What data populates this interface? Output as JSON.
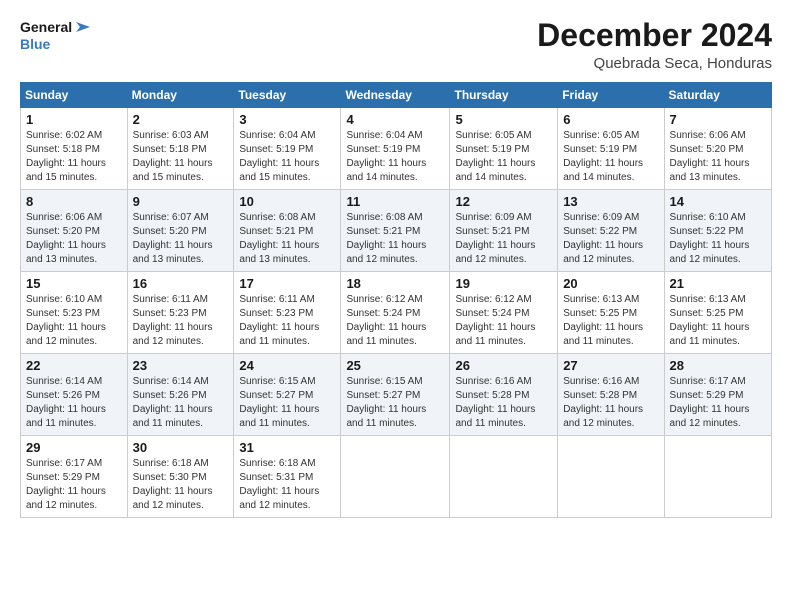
{
  "logo": {
    "line1": "General",
    "line2": "Blue"
  },
  "title": "December 2024",
  "location": "Quebrada Seca, Honduras",
  "days_of_week": [
    "Sunday",
    "Monday",
    "Tuesday",
    "Wednesday",
    "Thursday",
    "Friday",
    "Saturday"
  ],
  "weeks": [
    [
      {
        "day": "1",
        "sunrise": "6:02 AM",
        "sunset": "5:18 PM",
        "daylight": "11 hours and 15 minutes."
      },
      {
        "day": "2",
        "sunrise": "6:03 AM",
        "sunset": "5:18 PM",
        "daylight": "11 hours and 15 minutes."
      },
      {
        "day": "3",
        "sunrise": "6:04 AM",
        "sunset": "5:19 PM",
        "daylight": "11 hours and 15 minutes."
      },
      {
        "day": "4",
        "sunrise": "6:04 AM",
        "sunset": "5:19 PM",
        "daylight": "11 hours and 14 minutes."
      },
      {
        "day": "5",
        "sunrise": "6:05 AM",
        "sunset": "5:19 PM",
        "daylight": "11 hours and 14 minutes."
      },
      {
        "day": "6",
        "sunrise": "6:05 AM",
        "sunset": "5:19 PM",
        "daylight": "11 hours and 14 minutes."
      },
      {
        "day": "7",
        "sunrise": "6:06 AM",
        "sunset": "5:20 PM",
        "daylight": "11 hours and 13 minutes."
      }
    ],
    [
      {
        "day": "8",
        "sunrise": "6:06 AM",
        "sunset": "5:20 PM",
        "daylight": "11 hours and 13 minutes."
      },
      {
        "day": "9",
        "sunrise": "6:07 AM",
        "sunset": "5:20 PM",
        "daylight": "11 hours and 13 minutes."
      },
      {
        "day": "10",
        "sunrise": "6:08 AM",
        "sunset": "5:21 PM",
        "daylight": "11 hours and 13 minutes."
      },
      {
        "day": "11",
        "sunrise": "6:08 AM",
        "sunset": "5:21 PM",
        "daylight": "11 hours and 12 minutes."
      },
      {
        "day": "12",
        "sunrise": "6:09 AM",
        "sunset": "5:21 PM",
        "daylight": "11 hours and 12 minutes."
      },
      {
        "day": "13",
        "sunrise": "6:09 AM",
        "sunset": "5:22 PM",
        "daylight": "11 hours and 12 minutes."
      },
      {
        "day": "14",
        "sunrise": "6:10 AM",
        "sunset": "5:22 PM",
        "daylight": "11 hours and 12 minutes."
      }
    ],
    [
      {
        "day": "15",
        "sunrise": "6:10 AM",
        "sunset": "5:23 PM",
        "daylight": "11 hours and 12 minutes."
      },
      {
        "day": "16",
        "sunrise": "6:11 AM",
        "sunset": "5:23 PM",
        "daylight": "11 hours and 12 minutes."
      },
      {
        "day": "17",
        "sunrise": "6:11 AM",
        "sunset": "5:23 PM",
        "daylight": "11 hours and 11 minutes."
      },
      {
        "day": "18",
        "sunrise": "6:12 AM",
        "sunset": "5:24 PM",
        "daylight": "11 hours and 11 minutes."
      },
      {
        "day": "19",
        "sunrise": "6:12 AM",
        "sunset": "5:24 PM",
        "daylight": "11 hours and 11 minutes."
      },
      {
        "day": "20",
        "sunrise": "6:13 AM",
        "sunset": "5:25 PM",
        "daylight": "11 hours and 11 minutes."
      },
      {
        "day": "21",
        "sunrise": "6:13 AM",
        "sunset": "5:25 PM",
        "daylight": "11 hours and 11 minutes."
      }
    ],
    [
      {
        "day": "22",
        "sunrise": "6:14 AM",
        "sunset": "5:26 PM",
        "daylight": "11 hours and 11 minutes."
      },
      {
        "day": "23",
        "sunrise": "6:14 AM",
        "sunset": "5:26 PM",
        "daylight": "11 hours and 11 minutes."
      },
      {
        "day": "24",
        "sunrise": "6:15 AM",
        "sunset": "5:27 PM",
        "daylight": "11 hours and 11 minutes."
      },
      {
        "day": "25",
        "sunrise": "6:15 AM",
        "sunset": "5:27 PM",
        "daylight": "11 hours and 11 minutes."
      },
      {
        "day": "26",
        "sunrise": "6:16 AM",
        "sunset": "5:28 PM",
        "daylight": "11 hours and 11 minutes."
      },
      {
        "day": "27",
        "sunrise": "6:16 AM",
        "sunset": "5:28 PM",
        "daylight": "11 hours and 12 minutes."
      },
      {
        "day": "28",
        "sunrise": "6:17 AM",
        "sunset": "5:29 PM",
        "daylight": "11 hours and 12 minutes."
      }
    ],
    [
      {
        "day": "29",
        "sunrise": "6:17 AM",
        "sunset": "5:29 PM",
        "daylight": "11 hours and 12 minutes."
      },
      {
        "day": "30",
        "sunrise": "6:18 AM",
        "sunset": "5:30 PM",
        "daylight": "11 hours and 12 minutes."
      },
      {
        "day": "31",
        "sunrise": "6:18 AM",
        "sunset": "5:31 PM",
        "daylight": "11 hours and 12 minutes."
      },
      null,
      null,
      null,
      null
    ]
  ],
  "labels": {
    "sunrise": "Sunrise:",
    "sunset": "Sunset:",
    "daylight": "Daylight:"
  }
}
